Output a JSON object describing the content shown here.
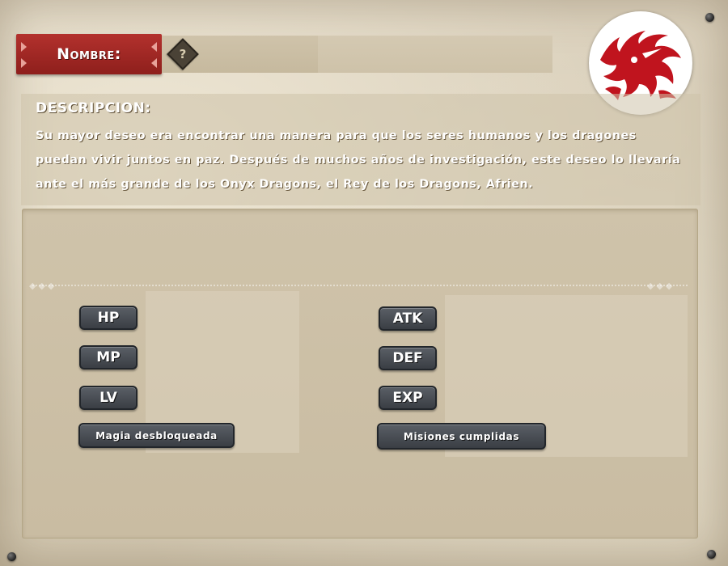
{
  "header": {
    "name_label": "Nombre:",
    "name_value": "",
    "help_icon": "question-mark-icon",
    "help_symbol": "?",
    "emblem_icon": "red-dragon-emblem-icon"
  },
  "description": {
    "title": "DESCRIPCION:",
    "text": "Su mayor deseo era encontrar una manera para que los seres humanos y los dragones puedan vivir juntos en paz. Después de muchos años de investigación, este deseo lo llevaría ante el más grande de los Onyx Dragons, el Rey de los Dragons, Afrien."
  },
  "stats": {
    "left": [
      {
        "label": "HP",
        "value": ""
      },
      {
        "label": "MP",
        "value": ""
      },
      {
        "label": "LV",
        "value": ""
      },
      {
        "label": "Magia desbloqueada",
        "value": ""
      }
    ],
    "right": [
      {
        "label": "ATK",
        "value": ""
      },
      {
        "label": "DEF",
        "value": ""
      },
      {
        "label": "EXP",
        "value": ""
      },
      {
        "label": "Misiones cumplidas",
        "value": ""
      }
    ]
  },
  "colors": {
    "label_red": "#a62a26",
    "button_dark": "#3a3e44",
    "emblem_red": "#c0141e",
    "parchment": "#d8ceb9"
  }
}
